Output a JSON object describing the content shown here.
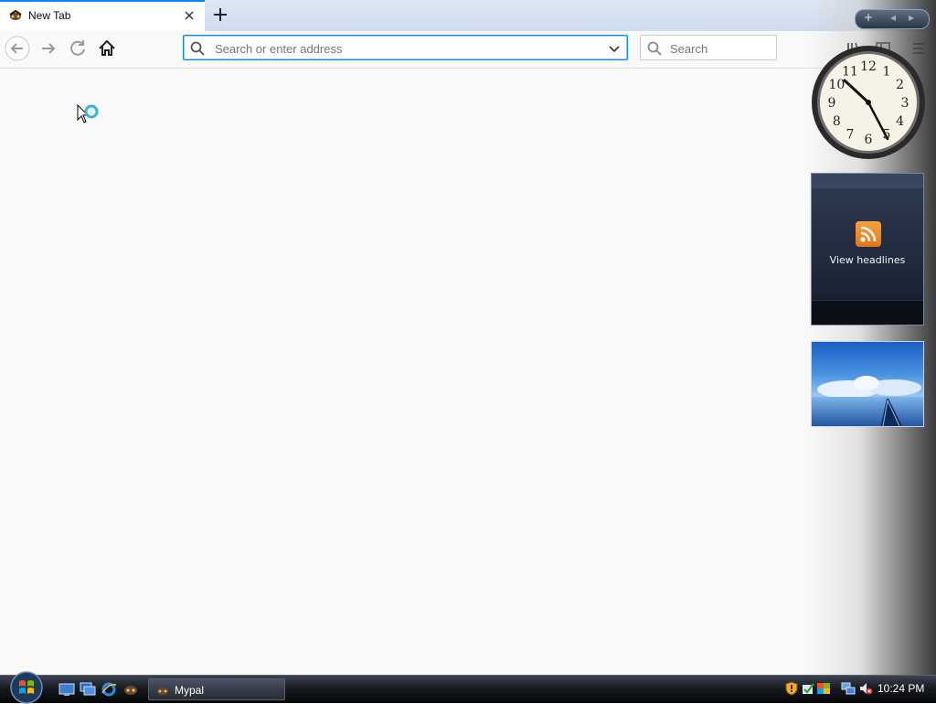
{
  "browser": {
    "tab": {
      "title": "New Tab"
    },
    "urlbar": {
      "placeholder": "Search or enter address"
    },
    "searchbar": {
      "placeholder": "Search"
    }
  },
  "sidebar": {
    "clock": {
      "hour_numerals": [
        "12",
        "1",
        "2",
        "3",
        "4",
        "5",
        "6",
        "7",
        "8",
        "9",
        "10",
        "11"
      ]
    },
    "rss": {
      "label": "View headlines"
    }
  },
  "taskbar": {
    "task_button": {
      "label": "Mypal"
    },
    "clock": "10:24 PM"
  },
  "colors": {
    "accent": "#0a84ff",
    "rss": "#f39a2e",
    "taskbar": "#15181d"
  }
}
